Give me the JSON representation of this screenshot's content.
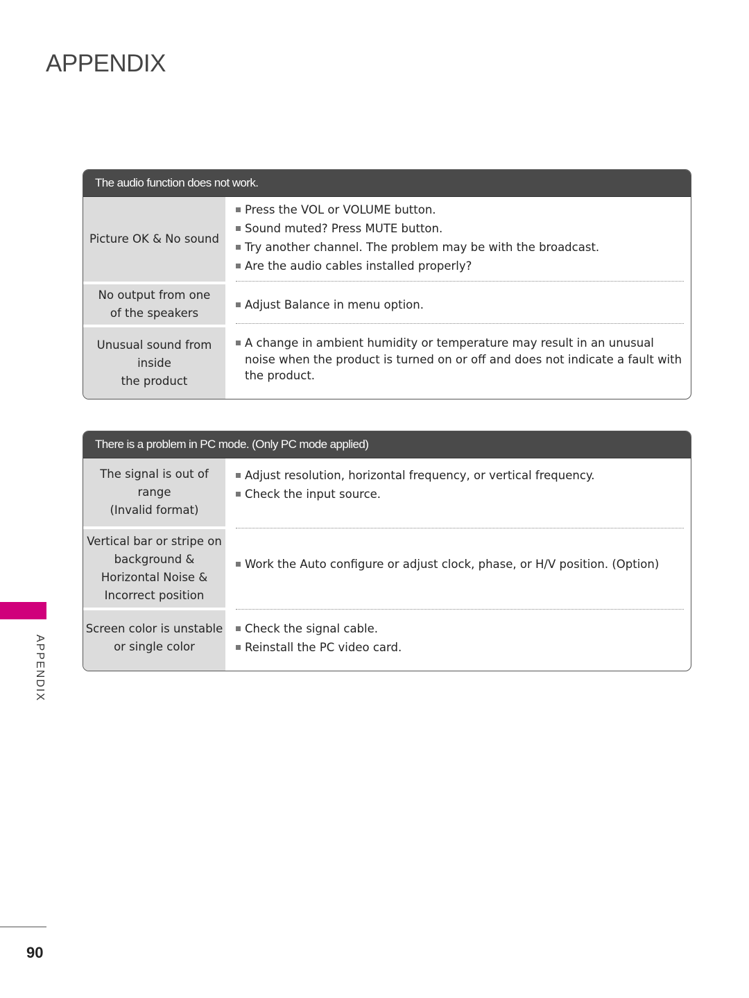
{
  "page": {
    "title": "APPENDIX",
    "side_label": "APPENDIX",
    "page_number": "90",
    "accent_color": "#d0007b"
  },
  "sections": [
    {
      "header": "The audio function does not work.",
      "rows": [
        {
          "label": [
            "Picture OK & No sound"
          ],
          "items": [
            "Press the VOL or VOLUME button.",
            "Sound muted? Press MUTE button.",
            "Try another channel. The problem may be with the broadcast.",
            "Are the audio cables installed properly?"
          ]
        },
        {
          "label": [
            "No output from one",
            "of the speakers"
          ],
          "items": [
            "Adjust Balance in menu option."
          ]
        },
        {
          "label": [
            "Unusual sound from",
            "inside",
            "the product"
          ],
          "items": [
            "A change in ambient humidity or temperature may result in an unusual noise when the product is turned on or off and does not indicate a fault with the product."
          ]
        }
      ]
    },
    {
      "header": "There is a problem in PC mode. (Only PC mode applied)",
      "rows": [
        {
          "label": [
            "The signal is out of range",
            "(Invalid format)"
          ],
          "items": [
            "Adjust resolution, horizontal frequency, or vertical frequency.",
            "Check the input source."
          ]
        },
        {
          "label": [
            "Vertical bar or stripe on",
            "background &",
            "Horizontal Noise &",
            "Incorrect position"
          ],
          "items": [
            "Work the Auto configure or adjust clock, phase, or H/V position. (Option)"
          ]
        },
        {
          "label": [
            "Screen color is unstable",
            "or single color"
          ],
          "items": [
            "Check the signal cable.",
            "Reinstall the PC video card."
          ]
        }
      ]
    }
  ]
}
